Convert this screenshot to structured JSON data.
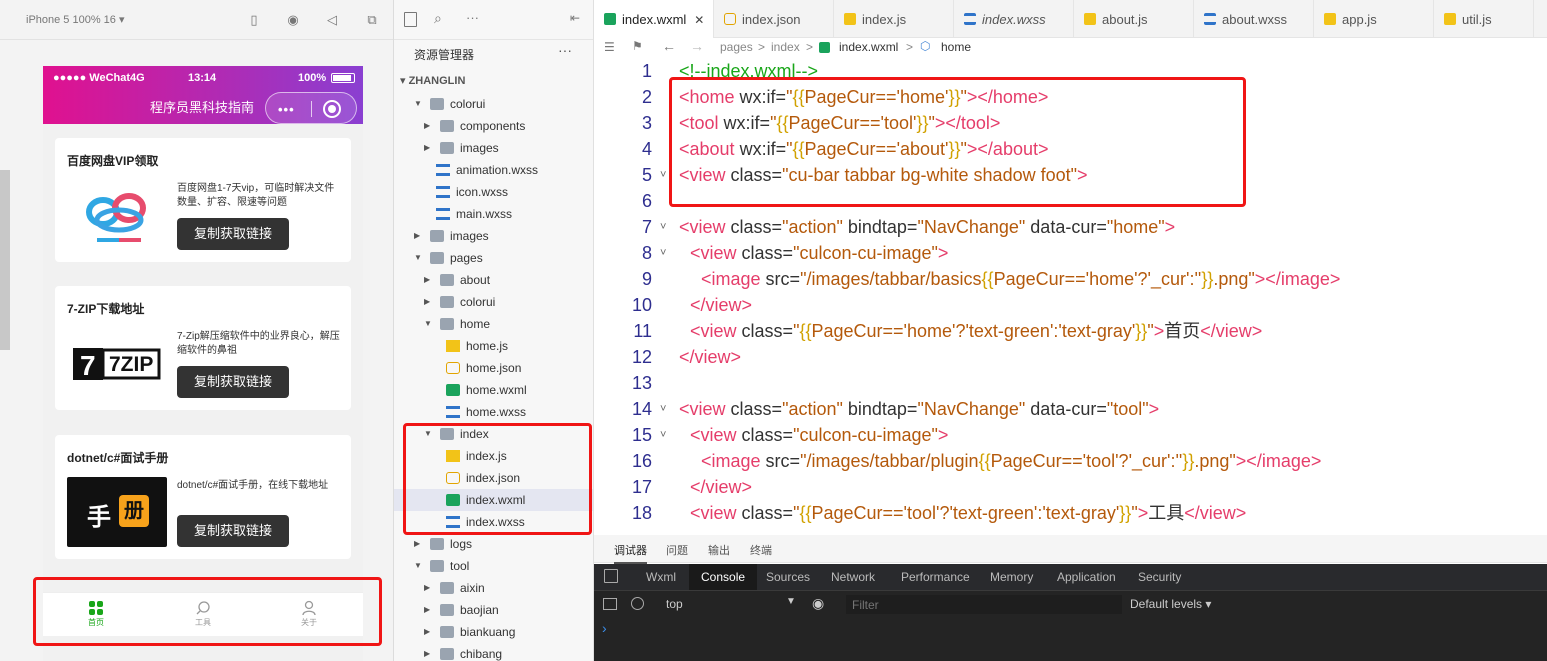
{
  "simulator": {
    "device_label": "iPhone 5 100% 16 ▾",
    "status": {
      "carrier": "●●●●● WeChat4G",
      "time": "13:14",
      "battery": "100%"
    },
    "nav_title": "程序员黑科技指南",
    "capsule_dots": "•••",
    "cards": [
      {
        "title": "百度网盘VIP领取",
        "desc": "百度网盘1-7天vip，可临时解决文件数量、扩容、限速等问题",
        "button": "复制获取链接"
      },
      {
        "title": "7-ZIP下载地址",
        "desc": "7-Zip解压缩软件中的业界良心，解压缩软件的鼻祖",
        "button": "复制获取链接",
        "logo": "7ZIP"
      },
      {
        "title": "dotnet/c#面试手册",
        "desc": "dotnet/c#面试手册，在线下载地址",
        "button": "复制获取链接",
        "logo_text": "手",
        "logo_badge": "册"
      }
    ],
    "tabbar": [
      {
        "label": "首页",
        "active": true
      },
      {
        "label": "工具",
        "active": false
      },
      {
        "label": "关于",
        "active": false
      }
    ]
  },
  "explorer": {
    "title": "资源管理器",
    "more": "···",
    "root": "ZHANGLIN",
    "tree": [
      {
        "label": "colorui",
        "type": "folder-open",
        "level": 1
      },
      {
        "label": "components",
        "type": "folder",
        "level": 2
      },
      {
        "label": "images",
        "type": "folder",
        "level": 2
      },
      {
        "label": "animation.wxss",
        "type": "wxss",
        "level": 2
      },
      {
        "label": "icon.wxss",
        "type": "wxss",
        "level": 2
      },
      {
        "label": "main.wxss",
        "type": "wxss",
        "level": 2
      },
      {
        "label": "images",
        "type": "folder",
        "level": 1
      },
      {
        "label": "pages",
        "type": "folder-open",
        "level": 1
      },
      {
        "label": "about",
        "type": "folder",
        "level": 2
      },
      {
        "label": "colorui",
        "type": "folder",
        "level": 2
      },
      {
        "label": "home",
        "type": "folder-open",
        "level": 2
      },
      {
        "label": "home.js",
        "type": "js",
        "level": 3
      },
      {
        "label": "home.json",
        "type": "json",
        "level": 3
      },
      {
        "label": "home.wxml",
        "type": "wxml",
        "level": 3
      },
      {
        "label": "home.wxss",
        "type": "wxss",
        "level": 3
      },
      {
        "label": "index",
        "type": "folder-open",
        "level": 2
      },
      {
        "label": "index.js",
        "type": "js",
        "level": 3
      },
      {
        "label": "index.json",
        "type": "json",
        "level": 3
      },
      {
        "label": "index.wxml",
        "type": "wxml",
        "level": 3,
        "selected": true
      },
      {
        "label": "index.wxss",
        "type": "wxss",
        "level": 3
      },
      {
        "label": "logs",
        "type": "folder",
        "level": 1
      },
      {
        "label": "tool",
        "type": "folder-open",
        "level": 1
      },
      {
        "label": "aixin",
        "type": "folder",
        "level": 2
      },
      {
        "label": "baojian",
        "type": "folder",
        "level": 2
      },
      {
        "label": "biankuang",
        "type": "folder",
        "level": 2
      },
      {
        "label": "chibang",
        "type": "folder",
        "level": 2
      }
    ]
  },
  "editor": {
    "tabs": [
      {
        "label": "index.wxml",
        "type": "wxml",
        "active": true,
        "close": "✕"
      },
      {
        "label": "index.json",
        "type": "json"
      },
      {
        "label": "index.js",
        "type": "js"
      },
      {
        "label": "index.wxss",
        "type": "wxss",
        "italic": true
      },
      {
        "label": "about.js",
        "type": "js"
      },
      {
        "label": "about.wxss",
        "type": "wxss"
      },
      {
        "label": "app.js",
        "type": "js"
      },
      {
        "label": "util.js",
        "type": "js"
      }
    ],
    "breadcrumb": [
      "pages",
      "index",
      "index.wxml",
      "home"
    ],
    "lines": [
      {
        "n": "1",
        "fold": "",
        "indent": 0,
        "tokens": [
          [
            "cm",
            "<!--index.wxml-->"
          ]
        ]
      },
      {
        "n": "2",
        "fold": "",
        "indent": 0,
        "tokens": [
          [
            "tg",
            "<home"
          ],
          [
            "at",
            " wx:if="
          ],
          [
            "st",
            "\""
          ],
          [
            "br",
            "{{"
          ],
          [
            "st",
            "PageCur=='home'"
          ],
          [
            "br",
            "}}"
          ],
          [
            "st",
            "\""
          ],
          [
            "tg",
            "></home>"
          ]
        ]
      },
      {
        "n": "3",
        "fold": "",
        "indent": 0,
        "tokens": [
          [
            "tg",
            "<tool"
          ],
          [
            "at",
            " wx:if="
          ],
          [
            "st",
            "\""
          ],
          [
            "br",
            "{{"
          ],
          [
            "st",
            "PageCur=='tool'"
          ],
          [
            "br",
            "}}"
          ],
          [
            "st",
            "\""
          ],
          [
            "tg",
            "></tool>"
          ]
        ]
      },
      {
        "n": "4",
        "fold": "",
        "indent": 0,
        "tokens": [
          [
            "tg",
            "<about"
          ],
          [
            "at",
            " wx:if="
          ],
          [
            "st",
            "\""
          ],
          [
            "br",
            "{{"
          ],
          [
            "st",
            "PageCur=='about'"
          ],
          [
            "br",
            "}}"
          ],
          [
            "st",
            "\""
          ],
          [
            "tg",
            "></about>"
          ]
        ]
      },
      {
        "n": "5",
        "fold": "˅",
        "indent": 0,
        "tokens": [
          [
            "tg",
            "<view"
          ],
          [
            "at",
            " class="
          ],
          [
            "st",
            "\"cu-bar tabbar bg-white shadow foot\""
          ],
          [
            "tg",
            ">"
          ]
        ]
      },
      {
        "n": "6",
        "fold": "",
        "indent": 0,
        "tokens": []
      },
      {
        "n": "7",
        "fold": "˅",
        "indent": 0,
        "tokens": [
          [
            "tg",
            "<view"
          ],
          [
            "at",
            " class="
          ],
          [
            "st",
            "\"action\""
          ],
          [
            "at",
            " bindtap="
          ],
          [
            "st",
            "\"NavChange\""
          ],
          [
            "at",
            " data-cur="
          ],
          [
            "st",
            "\"home\""
          ],
          [
            "tg",
            ">"
          ]
        ]
      },
      {
        "n": "8",
        "fold": "˅",
        "indent": 1,
        "tokens": [
          [
            "tg",
            "<view"
          ],
          [
            "at",
            " class="
          ],
          [
            "st",
            "\"culcon-cu-image\""
          ],
          [
            "tg",
            ">"
          ]
        ]
      },
      {
        "n": "9",
        "fold": "",
        "indent": 2,
        "tokens": [
          [
            "tg",
            "<image"
          ],
          [
            "at",
            " src="
          ],
          [
            "st",
            "\"/images/tabbar/basics"
          ],
          [
            "br",
            "{{"
          ],
          [
            "st",
            "PageCur=='home'?'_cur':''"
          ],
          [
            "br",
            "}}"
          ],
          [
            "st",
            ".png\""
          ],
          [
            "tg",
            "></image>"
          ]
        ]
      },
      {
        "n": "10",
        "fold": "",
        "indent": 1,
        "tokens": [
          [
            "tg",
            "</view>"
          ]
        ]
      },
      {
        "n": "11",
        "fold": "",
        "indent": 1,
        "tokens": [
          [
            "tg",
            "<view"
          ],
          [
            "at",
            " class="
          ],
          [
            "st",
            "\""
          ],
          [
            "br",
            "{{"
          ],
          [
            "st",
            "PageCur=='home'?'text-green':'text-gray'"
          ],
          [
            "br",
            "}}"
          ],
          [
            "st",
            "\""
          ],
          [
            "tg",
            ">"
          ],
          [
            "at",
            "首页"
          ],
          [
            "tg",
            "</view>"
          ]
        ]
      },
      {
        "n": "12",
        "fold": "",
        "indent": 0,
        "tokens": [
          [
            "tg",
            "</view>"
          ]
        ]
      },
      {
        "n": "13",
        "fold": "",
        "indent": 0,
        "tokens": []
      },
      {
        "n": "14",
        "fold": "˅",
        "indent": 0,
        "tokens": [
          [
            "tg",
            "<view"
          ],
          [
            "at",
            " class="
          ],
          [
            "st",
            "\"action\""
          ],
          [
            "at",
            " bindtap="
          ],
          [
            "st",
            "\"NavChange\""
          ],
          [
            "at",
            " data-cur="
          ],
          [
            "st",
            "\"tool\""
          ],
          [
            "tg",
            ">"
          ]
        ]
      },
      {
        "n": "15",
        "fold": "˅",
        "indent": 1,
        "tokens": [
          [
            "tg",
            "<view"
          ],
          [
            "at",
            " class="
          ],
          [
            "st",
            "\"culcon-cu-image\""
          ],
          [
            "tg",
            ">"
          ]
        ]
      },
      {
        "n": "16",
        "fold": "",
        "indent": 2,
        "tokens": [
          [
            "tg",
            "<image"
          ],
          [
            "at",
            " src="
          ],
          [
            "st",
            "\"/images/tabbar/plugin"
          ],
          [
            "br",
            "{{"
          ],
          [
            "st",
            "PageCur=='tool'?'_cur':''"
          ],
          [
            "br",
            "}}"
          ],
          [
            "st",
            ".png\""
          ],
          [
            "tg",
            "></image>"
          ]
        ]
      },
      {
        "n": "17",
        "fold": "",
        "indent": 1,
        "tokens": [
          [
            "tg",
            "</view>"
          ]
        ]
      },
      {
        "n": "18",
        "fold": "",
        "indent": 1,
        "tokens": [
          [
            "tg",
            "<view"
          ],
          [
            "at",
            " class="
          ],
          [
            "st",
            "\""
          ],
          [
            "br",
            "{{"
          ],
          [
            "st",
            "PageCur=='tool'?'text-green':'text-gray'"
          ],
          [
            "br",
            "}}"
          ],
          [
            "st",
            "\""
          ],
          [
            "tg",
            ">"
          ],
          [
            "at",
            "工具"
          ],
          [
            "tg",
            "</view>"
          ]
        ]
      }
    ]
  },
  "panel": {
    "tabs": [
      "调试器",
      "问题",
      "输出",
      "终端"
    ],
    "devtools_tabs": [
      "Wxml",
      "Console",
      "Sources",
      "Network",
      "Performance",
      "Memory",
      "Application",
      "Security"
    ],
    "active_devtools_tab": "Console",
    "context": "top",
    "filter_placeholder": "Filter",
    "levels": "Default levels ▾",
    "prompt": "›"
  },
  "colors": {
    "accent_red": "#f01515",
    "tag": "#e53d6a",
    "string": "#b4590b",
    "comment": "#19a619",
    "tab_active_green": "#19a619"
  }
}
